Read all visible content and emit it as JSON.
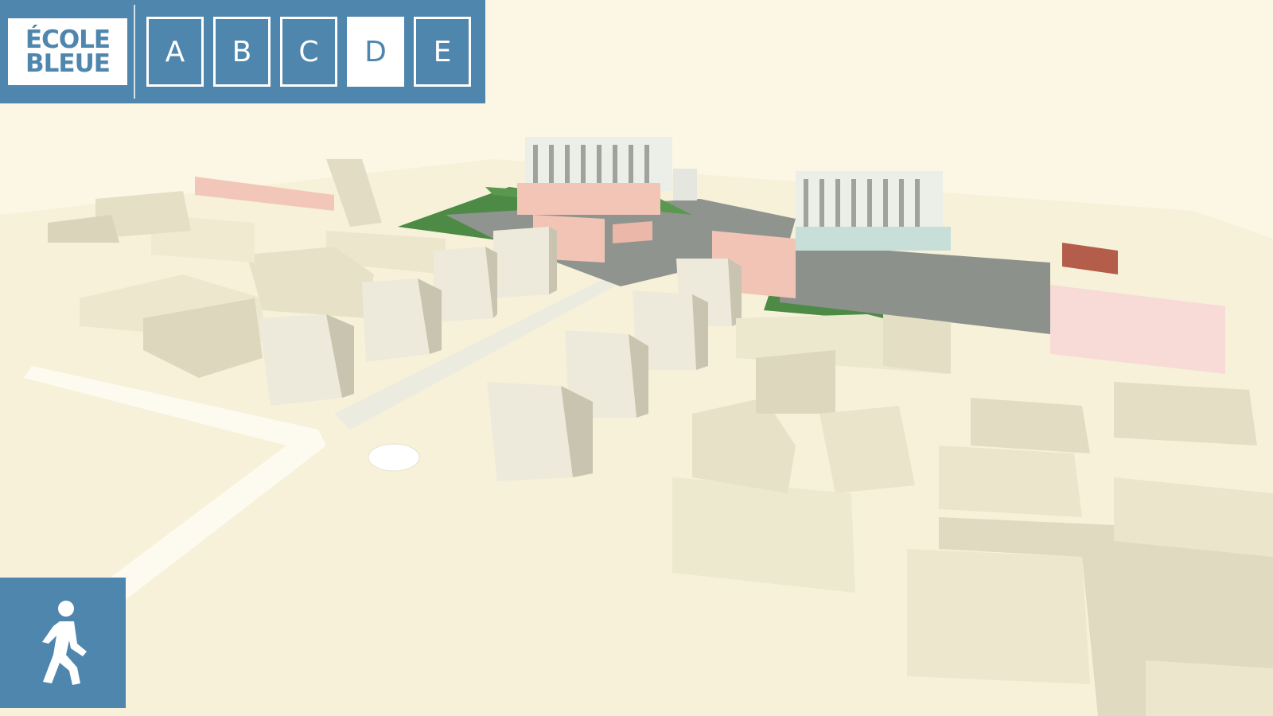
{
  "logo": {
    "line1": "ÉCOLE",
    "line2": "BLEUE"
  },
  "scenarios": [
    {
      "label": "A",
      "active": false
    },
    {
      "label": "B",
      "active": false
    },
    {
      "label": "C",
      "active": false
    },
    {
      "label": "D",
      "active": true
    },
    {
      "label": "E",
      "active": false
    }
  ],
  "walk_button": {
    "icon": "pedestrian-walk-icon"
  },
  "colors": {
    "accent": "#4f86ae",
    "ground": "#fbf7e4",
    "building": "#f1ecd2",
    "building_shade": "#dcd7bd",
    "lawn": "#4d8a45",
    "asphalt": "#8f948f",
    "pink_building": "#f1c4b6"
  }
}
